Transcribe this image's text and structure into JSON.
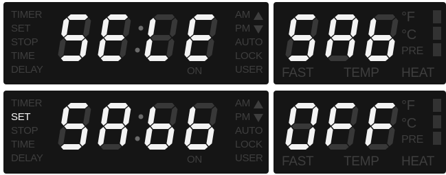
{
  "colors": {
    "panel_bg": "#151515",
    "segment_lit": "#f3f3f3",
    "segment_unlit": "#383838",
    "label_unlit": "#3e3e3e",
    "label_lit": "#f3f3f3"
  },
  "displays": [
    {
      "main": {
        "status_labels": [
          "TIMER",
          "SET",
          "STOP",
          "TIME",
          "DELAY"
        ],
        "lit_status_labels": [],
        "mode_labels": [
          "AM",
          "PM",
          "AUTO",
          "LOCK",
          "USER"
        ],
        "on_label": "ON",
        "digits": [
          "S",
          "E",
          "L",
          "E"
        ],
        "colon_lit": true
      },
      "temp": {
        "digits": [
          "S",
          "A",
          "b"
        ],
        "unit_f": "°F",
        "unit_c": "°C",
        "pre_label": "PRE",
        "heat_label": "HEAT",
        "fast_label": "FAST",
        "temp_label": "TEMP"
      }
    },
    {
      "main": {
        "status_labels": [
          "TIMER",
          "SET",
          "STOP",
          "TIME",
          "DELAY"
        ],
        "lit_status_labels": [
          "SET"
        ],
        "mode_labels": [
          "AM",
          "PM",
          "AUTO",
          "LOCK",
          "USER"
        ],
        "on_label": "ON",
        "digits": [
          "S",
          "A",
          "b",
          "b"
        ],
        "colon_lit": true
      },
      "temp": {
        "digits": [
          "O",
          "F",
          "F"
        ],
        "unit_f": "°F",
        "unit_c": "°C",
        "pre_label": "PRE",
        "heat_label": "HEAT",
        "fast_label": "FAST",
        "temp_label": "TEMP"
      }
    }
  ]
}
